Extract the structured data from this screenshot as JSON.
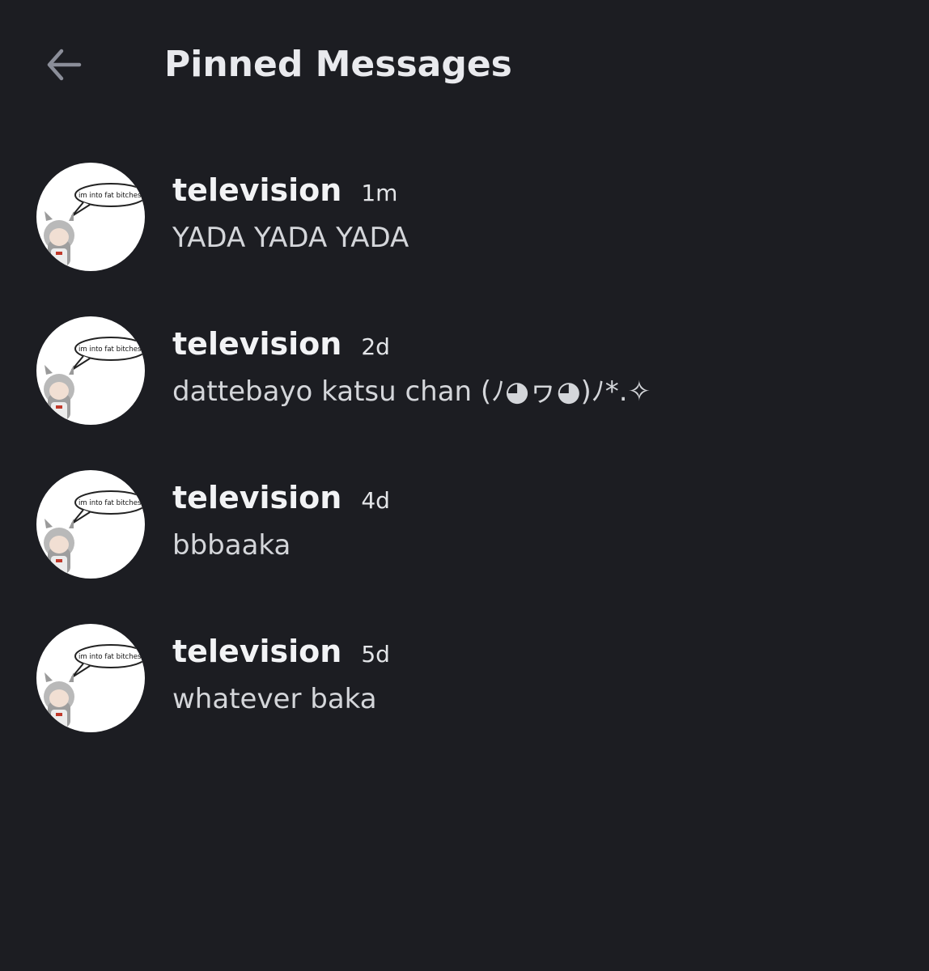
{
  "header": {
    "back_icon": "arrow-left-icon",
    "title": "Pinned Messages"
  },
  "messages": [
    {
      "author": "television",
      "time": "1m",
      "text": "YADA YADA YADA",
      "avatar_caption": "im into fat bitches"
    },
    {
      "author": "television",
      "time": "2d",
      "text": "dattebayo katsu chan (ﾉ◕ヮ◕)ﾉ*.✧",
      "avatar_caption": "im into fat bitches"
    },
    {
      "author": "television",
      "time": "4d",
      "text": "bbbaaka",
      "avatar_caption": "im into fat bitches"
    },
    {
      "author": "television",
      "time": "5d",
      "text": "whatever baka",
      "avatar_caption": "im into fat bitches"
    }
  ],
  "colors": {
    "background": "#1c1d22",
    "title": "#e9eaee",
    "author": "#f2f3f5",
    "message_text": "#d4d6da",
    "back_icon": "#8b8e99"
  }
}
